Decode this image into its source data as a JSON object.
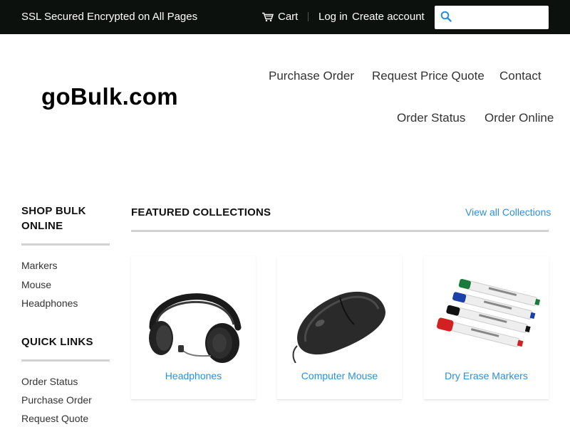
{
  "topbar": {
    "ssl_text": "SSL Secured Encrypted on All Pages",
    "cart_label": "Cart",
    "cart_icon": "cart-icon",
    "login_label": "Log in",
    "create_account_label": "Create account",
    "search": {
      "placeholder": "",
      "value": "",
      "icon": "search-icon"
    }
  },
  "header": {
    "logo_text": "goBulk.com",
    "nav": [
      {
        "label": "Purchase Order"
      },
      {
        "label": "Request Price Quote"
      },
      {
        "label": "Contact"
      },
      {
        "label": "Order Status"
      },
      {
        "label": "Order Online"
      }
    ]
  },
  "sidebar": {
    "shop_heading": "SHOP BULK ONLINE",
    "shop_links": [
      {
        "label": "Markers"
      },
      {
        "label": "Mouse"
      },
      {
        "label": "Headphones"
      }
    ],
    "quick_heading": "QUICK LINKS",
    "quick_links": [
      {
        "label": "Order Status"
      },
      {
        "label": "Purchase Order"
      },
      {
        "label": "Request Quote"
      }
    ]
  },
  "featured": {
    "title": "FEATURED COLLECTIONS",
    "view_all_label": "View all Collections",
    "collections": [
      {
        "label": "Headphones",
        "image": "headphones-image"
      },
      {
        "label": "Computer Mouse",
        "image": "computer-mouse-image"
      },
      {
        "label": "Dry Erase Markers",
        "image": "dry-erase-markers-image"
      }
    ]
  },
  "colors": {
    "topbar_bg": "#0d110d",
    "link_blue": "#2e8fd8",
    "rule_gray": "#d2d2d2"
  }
}
